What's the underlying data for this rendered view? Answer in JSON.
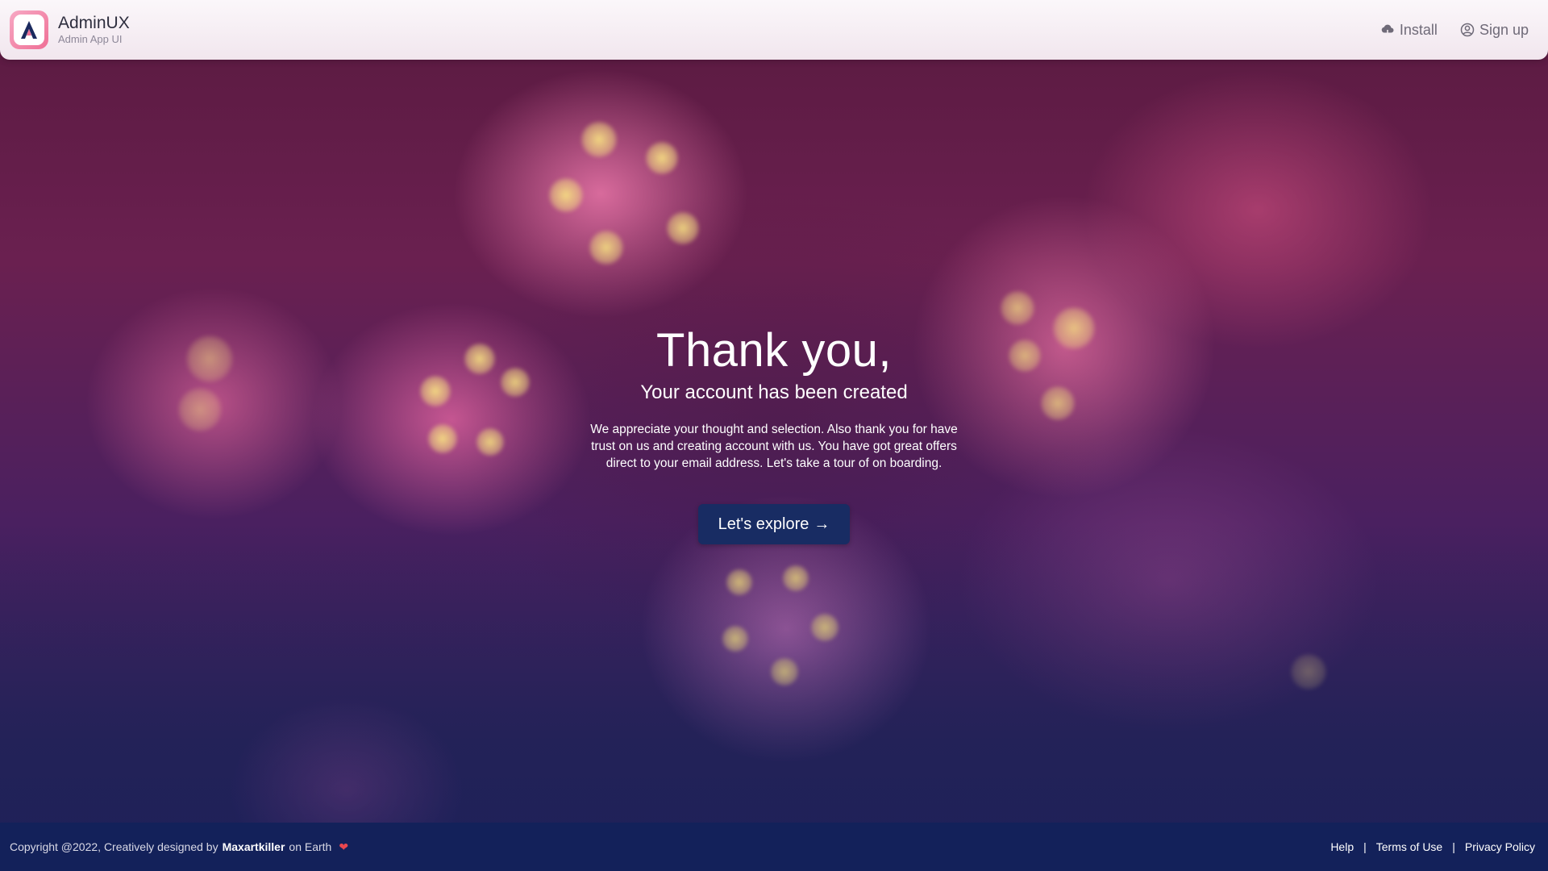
{
  "header": {
    "brand_name": "AdminUX",
    "brand_sub": "Admin App UI",
    "nav": [
      {
        "label": "Install",
        "icon": "cloud-download-icon"
      },
      {
        "label": "Sign up",
        "icon": "user-circle-icon"
      }
    ]
  },
  "main": {
    "title": "Thank you,",
    "subtitle": "Your account has been created",
    "description": "We appreciate your thought and selection. Also thank you for have trust on us and creating account with us. You have got great offers direct to your email address. Let's take a tour of on boarding.",
    "cta_label": "Let's explore",
    "cta_arrow": "→"
  },
  "footer": {
    "copyright_prefix": "Copyright @2022, Creatively designed by",
    "author": "Maxartkiller",
    "suffix": "on Earth",
    "heart": "❤",
    "links": [
      "Help",
      "Terms of Use",
      "Privacy Policy"
    ],
    "separator": "|"
  },
  "colors": {
    "accent": "#182c63",
    "footer_bg": "#13215a",
    "logo_pink": "#ef6f95",
    "heart": "#e8474f"
  }
}
